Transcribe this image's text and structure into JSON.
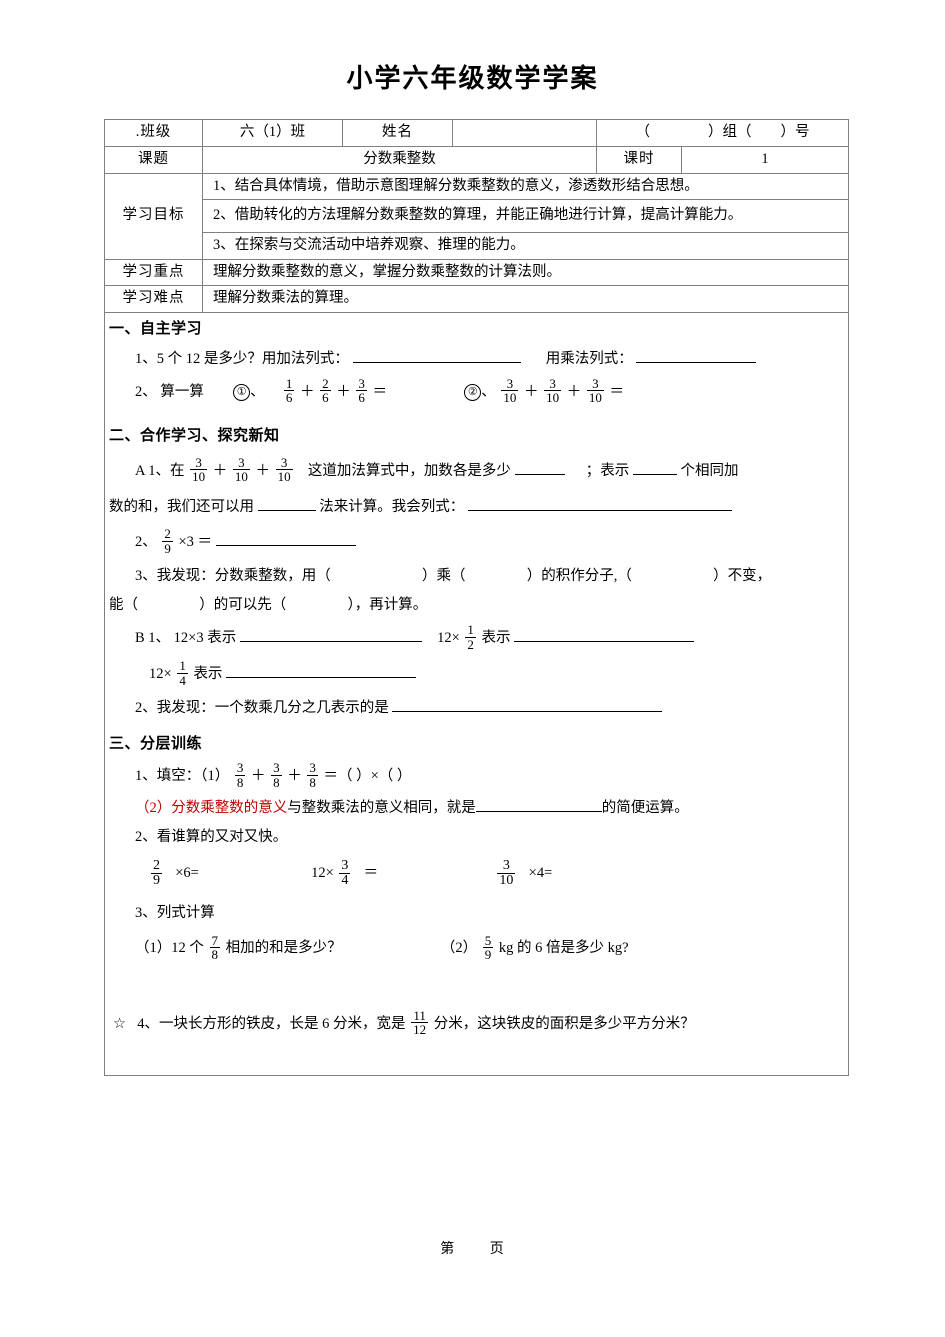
{
  "title": "小学六年级数学学案",
  "info_table": {
    "row1": {
      "class_label": ".班级",
      "class_value": "六（1）班",
      "name_label": "姓名",
      "name_value": "",
      "group_seat": "（　　　　）组（　　）号"
    },
    "row2": {
      "topic_label": "课题",
      "topic_value": "分数乘整数",
      "period_label": "课时",
      "period_value": "1"
    },
    "objectives_label": "学习目标",
    "objectives": [
      "1、结合具体情境，借助示意图理解分数乘整数的意义，渗透数形结合思想。",
      "2、借助转化的方法理解分数乘整数的算理，并能正确地进行计算，提高计算能力。",
      "3、在探索与交流活动中培养观察、推理的能力。"
    ],
    "keypoint_label": "学习重点",
    "keypoint_value": "理解分数乘整数的意义，掌握分数乘整数的计算法则。",
    "difficulty_label": "学习难点",
    "difficulty_value": "理解分数乘法的算理。"
  },
  "section1": {
    "heading": "一、自主学习",
    "q1_prefix": "1、5 个 12 是多少？用加法列式：",
    "q1_mid": "用乘法列式：",
    "q2_prefix": "2、 算一算",
    "q2_item1_mark": "①",
    "q2_item1_sep": "、",
    "q2_item1_f1_num": "1",
    "q2_item1_f1_den": "6",
    "q2_item1_op1": "＋",
    "q2_item1_f2_num": "2",
    "q2_item1_f2_den": "6",
    "q2_item1_op2": "＋",
    "q2_item1_f3_num": "3",
    "q2_item1_f3_den": "6",
    "q2_item1_eq": "＝",
    "q2_item2_mark": "②",
    "q2_item2_sep": "、",
    "q2_item2_f1_num": "3",
    "q2_item2_f1_den": "10",
    "q2_item2_op1": "＋",
    "q2_item2_f2_num": "3",
    "q2_item2_f2_den": "10",
    "q2_item2_op2": "＋",
    "q2_item2_f3_num": "3",
    "q2_item2_f3_den": "10",
    "q2_item2_eq": "＝"
  },
  "section2": {
    "heading": "二、合作学习、探究新知",
    "a1_prefix": "A 1、在",
    "a1_f1_num": "3",
    "a1_f1_den": "10",
    "a1_op1": "＋",
    "a1_f2_num": "3",
    "a1_f2_den": "10",
    "a1_op2": "＋",
    "a1_f3_num": "3",
    "a1_f3_den": "10",
    "a1_mid": "这道加法算式中，加数各是多少",
    "a1_semicolon": "；表示",
    "a1_tail": "个相同加",
    "a1_line2_a": "数的和，我们还可以用",
    "a1_line2_b": "法来计算。我会列式：",
    "a2_prefix": "2、",
    "a2_f_num": "2",
    "a2_f_den": "9",
    "a2_mid": "×3 ＝",
    "a3_line1": "3、我发现：分数乘整数，用（",
    "a3_l1b": "）乘（",
    "a3_l1c": "）的积作分子,（",
    "a3_l1d": "）不变，",
    "a3_line2a": "能（",
    "a3_line2b": "）的可以先（",
    "a3_line2c": "），再计算。",
    "b1_prefix": "B 1、  12×3 表示",
    "b1_second_a": "12×",
    "b1_second_f_num": "1",
    "b1_second_f_den": "2",
    "b1_second_b": "表示",
    "b1_third_a": "12×",
    "b1_third_f_num": "1",
    "b1_third_f_den": "4",
    "b1_third_b": "表示",
    "b2": "2、我发现：一个数乘几分之几表示的是"
  },
  "section3": {
    "heading": "三、分层训练",
    "q1_prefix": "1、填空：（1）",
    "q1_f1_num": "3",
    "q1_f1_den": "8",
    "q1_op1": "＋",
    "q1_f2_num": "3",
    "q1_f2_den": "8",
    "q1_op2": "＋",
    "q1_f3_num": "3",
    "q1_f3_den": "8",
    "q1_tail": "＝（        ）×（        ）",
    "q1b_red": "（2）分数乘整数的意义",
    "q1b_black": "与整数乘法的意义相同，就是",
    "q1b_tail": "的简便运算。",
    "q2_heading": "2、看谁算的又对又快。",
    "calc1_f_num": "2",
    "calc1_f_den": "9",
    "calc1_tail": "×6=",
    "calc2_head": "12×",
    "calc2_f_num": "3",
    "calc2_f_den": "4",
    "calc2_tail": "＝",
    "calc3_f_num": "3",
    "calc3_f_den": "10",
    "calc3_tail": "×4=",
    "q3_heading": "3、列式计算",
    "q3a_prefix": "（1）12 个",
    "q3a_f_num": "7",
    "q3a_f_den": "8",
    "q3a_tail": "相加的和是多少？",
    "q3b_prefix": "（2）",
    "q3b_f_num": "5",
    "q3b_f_den": "9",
    "q3b_tail": "kg 的 6 倍是多少 kg?",
    "q4_star": "☆",
    "q4_prefix": "4、一块长方形的铁皮，长是 6 分米，宽是",
    "q4_f_num": "11",
    "q4_f_den": "12",
    "q4_tail": "分米，这块铁皮的面积是多少平方分米？"
  },
  "footer": "第　　  页"
}
